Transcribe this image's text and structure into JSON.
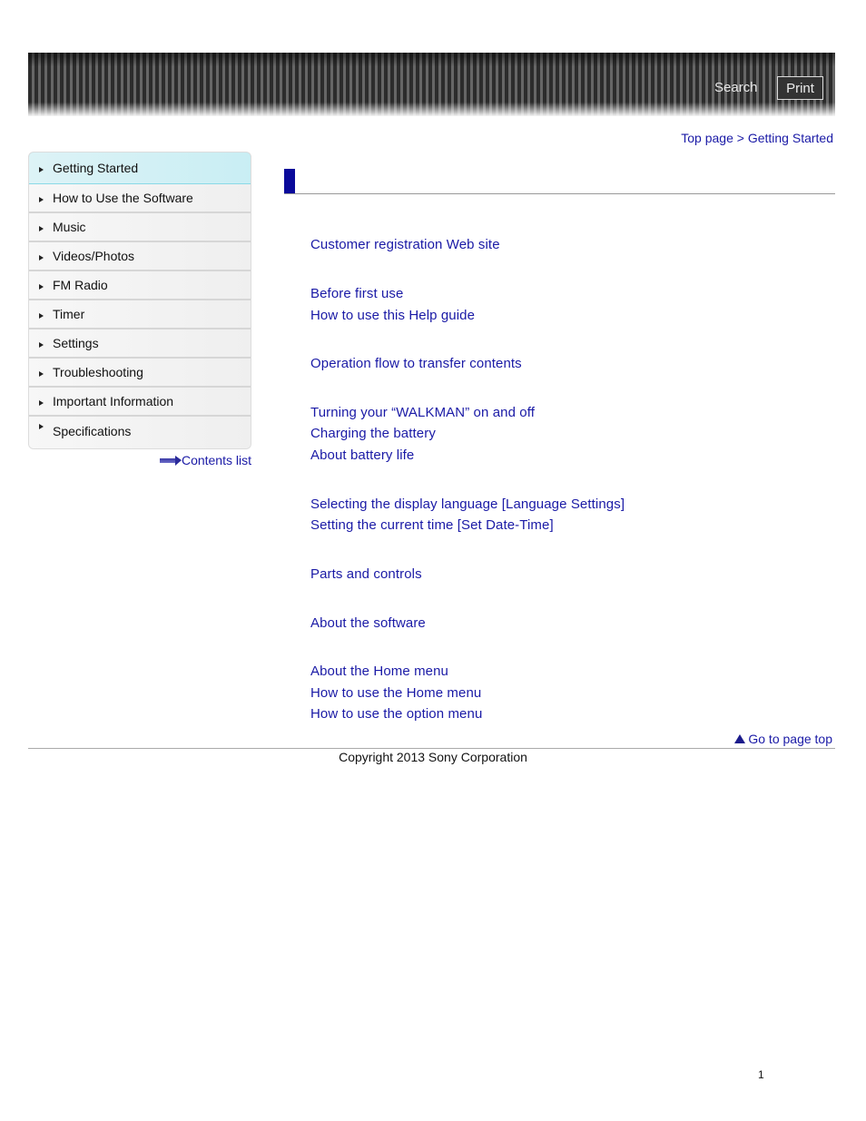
{
  "header": {
    "search_label": "Search",
    "print_label": "Print"
  },
  "breadcrumb": {
    "items": [
      "Top page",
      "Getting Started"
    ],
    "separator": ">"
  },
  "sidebar": {
    "items": [
      {
        "label": "Getting Started",
        "active": true
      },
      {
        "label": "How to Use the Software"
      },
      {
        "label": "Music"
      },
      {
        "label": "Videos/Photos"
      },
      {
        "label": "FM Radio"
      },
      {
        "label": "Timer"
      },
      {
        "label": "Settings"
      },
      {
        "label": "Troubleshooting"
      },
      {
        "label": "Important Information"
      },
      {
        "label": "Specifications"
      }
    ],
    "contents_list_label": "Contents list"
  },
  "main": {
    "title": "",
    "links": [
      "Customer registration Web site",
      "Before first use",
      "How to use this Help guide",
      "Operation flow to transfer contents",
      "Turning your “WALKMAN” on and off",
      "Charging the battery",
      "About battery life",
      "Selecting the display language [Language Settings]",
      "Setting the current time [Set Date-Time]",
      "Parts and controls",
      "About the software",
      "About the Home menu",
      "How to use the Home menu",
      "How to use the option menu"
    ]
  },
  "footer": {
    "go_top_label": "Go to page top",
    "copyright": "Copyright 2013 Sony Corporation",
    "page_number": "1"
  },
  "colors": {
    "link": "#1a1aa6",
    "title_bar": "#0a0a9a",
    "active_nav": "#c9eef4"
  }
}
